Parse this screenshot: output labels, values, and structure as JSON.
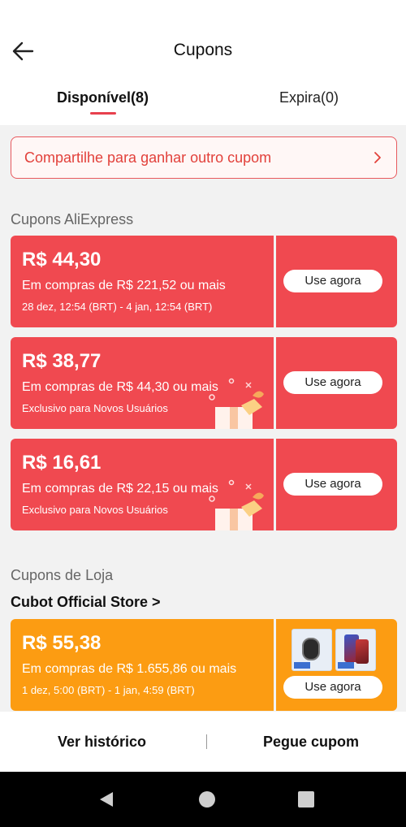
{
  "header": {
    "title": "Cupons",
    "back_icon": "back-arrow-icon"
  },
  "tabs": [
    {
      "label": "Disponível(8)",
      "active": true
    },
    {
      "label": "Expira(0)",
      "active": false
    }
  ],
  "share_banner": {
    "text": "Compartilhe para ganhar outro cupom",
    "icon": "chevron-right-icon"
  },
  "sections": {
    "aliexpress_title": "Cupons AliExpress",
    "store_title": "Cupons de Loja",
    "store_name": "Cubot Official Store >"
  },
  "aliexpress_coupons": [
    {
      "amount": "R$ 44,30",
      "condition": "Em compras de R$ 221,52 ou mais",
      "subtext": "28 dez, 12:54 (BRT) - 4 jan, 12:54 (BRT)",
      "button": "Use agora"
    },
    {
      "amount": "R$ 38,77",
      "condition": "Em compras de R$ 44,30 ou mais",
      "subtext": "Exclusivo para Novos Usuários",
      "button": "Use agora"
    },
    {
      "amount": "R$ 16,61",
      "condition": "Em compras de R$ 22,15 ou mais",
      "subtext": "Exclusivo para Novos Usuários",
      "button": "Use agora"
    }
  ],
  "store_coupon": {
    "amount": "R$ 55,38",
    "condition": "Em compras de R$ 1.655,86 ou mais",
    "subtext": "1 dez, 5:00 (BRT) - 1 jan, 4:59 (BRT)",
    "button": "Use agora",
    "product_thumbnails": [
      "smartwatch-thumbnail",
      "smartphone-thumbnail"
    ]
  },
  "bottom_bar": {
    "history": "Ver histórico",
    "get_coupon": "Pegue cupom"
  },
  "colors": {
    "accent_red": "#f04950",
    "store_orange": "#fc9c12",
    "tab_underline": "#e8404d"
  },
  "system_nav": [
    "back-triangle-icon",
    "home-circle-icon",
    "recents-square-icon"
  ]
}
